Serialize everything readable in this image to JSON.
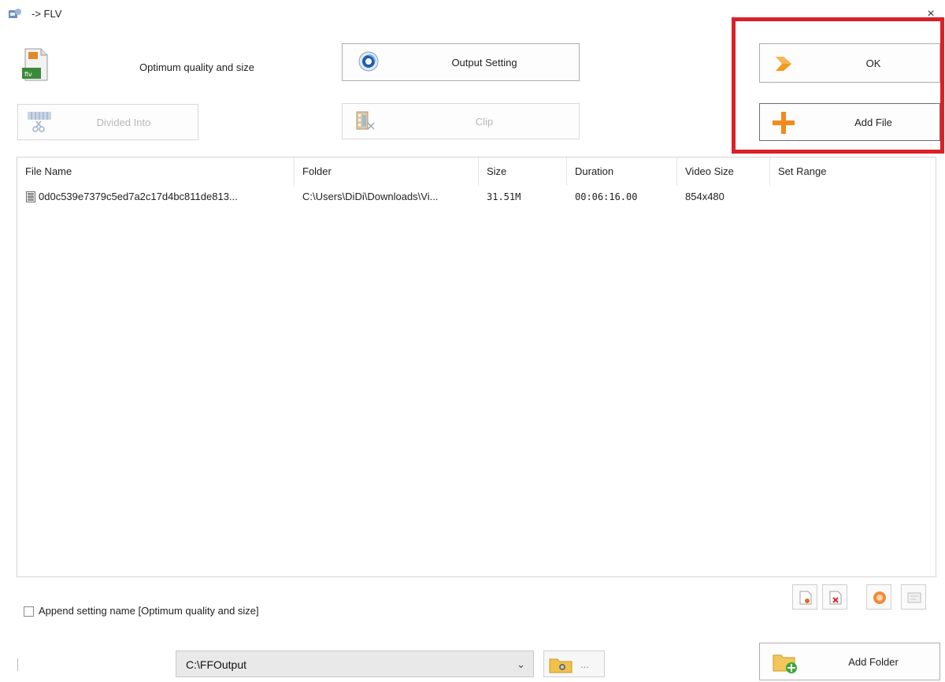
{
  "window": {
    "title": "-> FLV",
    "close_glyph": "×"
  },
  "profile": {
    "label": "Optimum quality and size",
    "icon": "flv-file-icon"
  },
  "toolbar": {
    "output_setting_label": "Output Setting",
    "divided_into_label": "Divided Into",
    "clip_label": "Clip",
    "ok_label": "OK",
    "add_file_label": "Add File",
    "add_folder_label": "Add Folder"
  },
  "file_list": {
    "columns": [
      "File Name",
      "Folder",
      "Size",
      "Duration",
      "Video Size",
      "Set Range"
    ],
    "rows": [
      {
        "file_name": "0d0c539e7379c5ed7a2c17d4bc811de813...",
        "folder": "C:\\Users\\DiDi\\Downloads\\Vi...",
        "size": "31.51M",
        "duration": "00:06:16.00",
        "video_size": "854x480",
        "set_range": ""
      }
    ]
  },
  "options": {
    "append_setting_label": "Append setting name [Optimum quality and size]",
    "append_setting_checked": false
  },
  "output": {
    "folder": "C:\\FFOutput",
    "browse_dots": "..."
  },
  "colors": {
    "highlight": "#d92127",
    "accent_orange": "#f39a1e"
  }
}
